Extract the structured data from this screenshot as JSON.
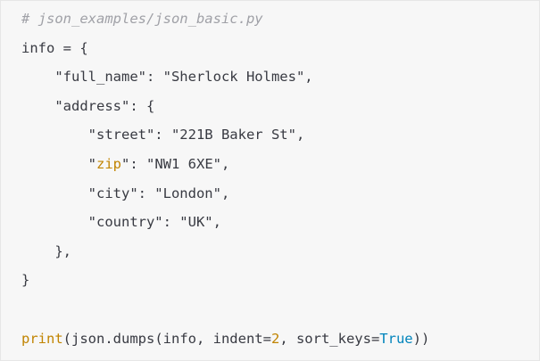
{
  "code": {
    "comment": "# json_examples/json_basic.py",
    "line2": "info = {",
    "line3": "    \"full_name\": \"Sherlock Holmes\",",
    "line4": "    \"address\": {",
    "line5": "        \"street\": \"221B Baker St\",",
    "line6_open_quote": "        \"",
    "line6_key": "zip",
    "line6_rest": "\": \"NW1 6XE\",",
    "line7": "        \"city\": \"London\",",
    "line8": "        \"country\": \"UK\",",
    "line9": "    },",
    "line10": "}",
    "line11": "",
    "line12_print": "print",
    "line12_mid": "(json.dumps(info, indent=",
    "line12_num": "2",
    "line12_mid2": ", sort_keys=",
    "line12_true": "True",
    "line12_end": "))"
  },
  "colors": {
    "background": "#f7f7f7",
    "text": "#383a42",
    "comment": "#a0a1a7",
    "highlight_orange": "#c18401",
    "highlight_blue": "#0184bc"
  }
}
